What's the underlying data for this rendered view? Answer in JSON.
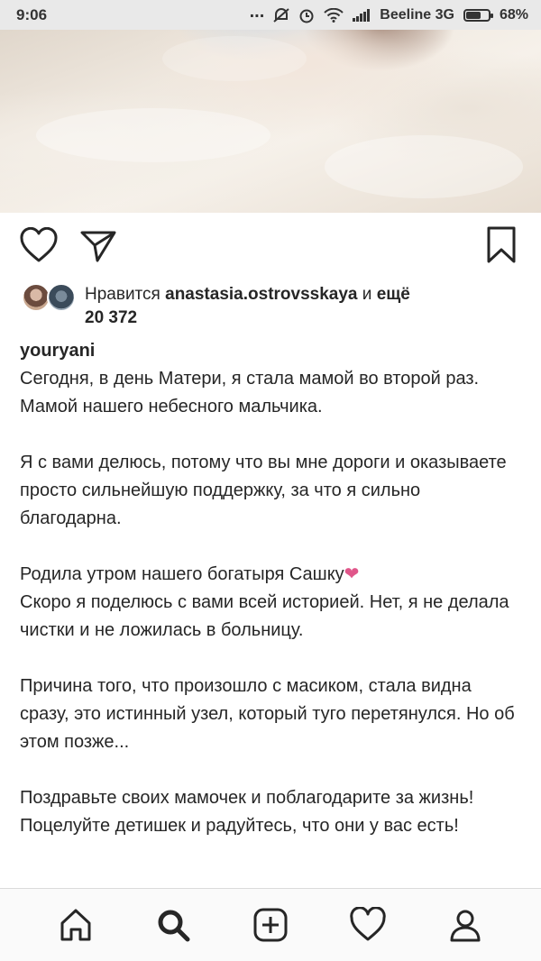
{
  "status_bar": {
    "time": "9:06",
    "dots": "...",
    "carrier": "Beeline 3G",
    "battery_percent_text": "68%",
    "battery_level": 0.68,
    "icons": [
      "dots-icon",
      "mute-icon",
      "alarm-icon",
      "wifi-icon",
      "signal-icon",
      "battery-icon"
    ]
  },
  "post": {
    "actions": {
      "like_icon": "heart-outline-icon",
      "share_icon": "paper-plane-icon",
      "save_icon": "bookmark-icon"
    },
    "likes": {
      "prefix": "Нравится",
      "user": "anastasia.ostrovsskaya",
      "joiner": "и",
      "more": "ещё",
      "count": "20 372"
    },
    "caption": {
      "username": "youryani",
      "p1": "Сегодня, в день Матери, я стала мамой во второй раз. Мамой нашего небесного мальчика.",
      "p2": "Я с вами делюсь, потому что вы мне дороги и оказываете просто сильнейшую поддержку, за что я сильно благодарна.",
      "p3a": "Родила утром нашего богатыря Сашку",
      "p3_heart": "❤",
      "p3b": "Скоро я поделюсь с вами всей историей. Нет, я не делала чистки и не ложилась в больницу.",
      "p4": "Причина того, что произошло с масиком, стала видна сразу, это истинный узел, который туго перетянулся. Но об этом позже...",
      "p5": "Поздравьте своих мамочек и поблагодарите за жизнь! Поцелуйте детишек и радуйтесь, что они у вас есть!"
    }
  },
  "bottom_nav": {
    "items": [
      "home-icon",
      "search-icon",
      "add-post-icon",
      "activity-heart-icon",
      "profile-icon"
    ],
    "active": "search-icon"
  },
  "colors": {
    "text": "#262626",
    "heart_emoji": "#e0568a",
    "nav_bg": "#fafafa",
    "status_bg": "#e9e9e9"
  }
}
